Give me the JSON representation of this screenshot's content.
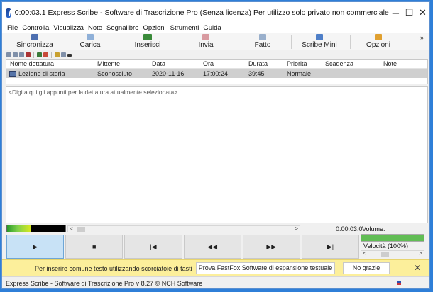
{
  "window": {
    "title": "0:00:03.1 Express Scribe - Software di Trascrizione Pro (Senza licenza) Per utilizzo solo privato non commerciale",
    "minimize": "─",
    "maximize": "☐",
    "close": "✕"
  },
  "menu": [
    "File",
    "Controlla",
    "Visualizza",
    "Note",
    "Segnalibro",
    "Opzioni",
    "Strumenti",
    "Guida"
  ],
  "toolbar": {
    "sync_label": "Sincronizza",
    "load_label": "Carica",
    "insert_label": "Inserisci",
    "send_label": "Invia",
    "done_label": "Fatto",
    "mini_label": "Scribe Mini",
    "options_label": "Opzioni",
    "more": "»"
  },
  "list": {
    "columns": [
      "Nome dettatura",
      "Mittente",
      "Data",
      "Ora",
      "Durata",
      "Priorità",
      "Scadenza",
      "Note"
    ],
    "rows": [
      {
        "name": "Lezione di storia",
        "sender": "Sconosciuto",
        "date": "2020-11-16",
        "time": "17:00:24",
        "duration": "39:45",
        "priority": "Normale",
        "due": "",
        "notes": ""
      }
    ]
  },
  "notes": {
    "placeholder": "<Digita qui gli appunti per la dettatura attualmente selezionata>"
  },
  "player": {
    "time": "0:00:03.0",
    "volume_label": "Volume:",
    "volume_level": 1.0,
    "speed_label": "Velocità (100%)",
    "speed_percent": 100,
    "wave_level": 0.4,
    "scroll_left": "<",
    "scroll_right": ">",
    "buttons": {
      "play": "▶",
      "stop": "■",
      "start": "|◀",
      "rewind": "◀◀",
      "forward": "▶▶",
      "end": "▶|"
    }
  },
  "notification": {
    "text": "Per inserire comune testo utilizzando scorciatoie di tasti",
    "try_label": "Prova FastFox Software di espansione testuale ora",
    "no_label": "No grazie",
    "close": "✕"
  },
  "status": {
    "text": "Express Scribe - Software di Trascrizione Pro v 8.27 © NCH Software"
  },
  "colors": {
    "notification_bg": "#fcef9b",
    "selected_row": "#cfcfcf",
    "active_button": "#c8e2f6",
    "volume_fill": "#61bd55"
  }
}
